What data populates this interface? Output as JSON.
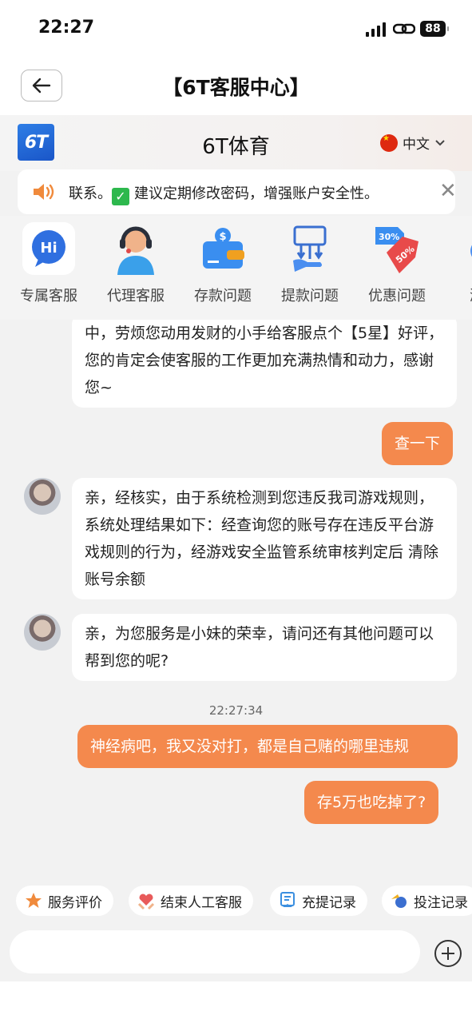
{
  "status": {
    "time": "22:27",
    "battery": "88"
  },
  "nav": {
    "title": "【6T客服中心】"
  },
  "brand": {
    "logo_text": "6T",
    "title": "6T体育",
    "language": "中文"
  },
  "notice": {
    "text_before": "联系。",
    "text_after": "建议定期修改密码，增强账户安全性。"
  },
  "categories": [
    {
      "label": "专属客服",
      "icon": "hi-chat-icon"
    },
    {
      "label": "代理客服",
      "icon": "headset-agent-icon"
    },
    {
      "label": "存款问题",
      "icon": "wallet-icon"
    },
    {
      "label": "提款问题",
      "icon": "withdraw-icon"
    },
    {
      "label": "优惠问题",
      "icon": "discount-tag-icon"
    },
    {
      "label": "游戏",
      "icon": "game-icon"
    }
  ],
  "chat": {
    "partial_message": "中，劳烦您动用发财的小手给客服点个【5星】好评，您的肯定会使客服的工作更加充满热情和动力，感谢您~",
    "user_msg_1": "查一下",
    "agent_msg_1": "亲，经核实，由于系统检测到您违反我司游戏规则，系统处理结果如下：经查询您的账号存在违反平台游戏规则的行为，经游戏安全监管系统审核判定后 清除账号余额",
    "agent_msg_2": "亲，为您服务是小妹的荣幸，请问还有其他问题可以帮到您的呢?",
    "timestamp": "22:27:34",
    "user_msg_2": "神经病吧，我又没对打，都是自己赌的哪里违规",
    "user_msg_3": "存5万也吃掉了?"
  },
  "quick_actions": [
    {
      "label": "服务评价",
      "icon": "star-icon",
      "color": "#f08a3c"
    },
    {
      "label": "结束人工客服",
      "icon": "heart-hands-icon",
      "color": "#e85a5a"
    },
    {
      "label": "充提记录",
      "icon": "receipt-icon",
      "color": "#3b8fe0"
    },
    {
      "label": "投注记录",
      "icon": "sports-ball-icon",
      "color": "#3b6fd0"
    }
  ],
  "input": {
    "placeholder": ""
  },
  "colors": {
    "accent": "#f4894d",
    "brand_blue": "#1f66d8"
  }
}
